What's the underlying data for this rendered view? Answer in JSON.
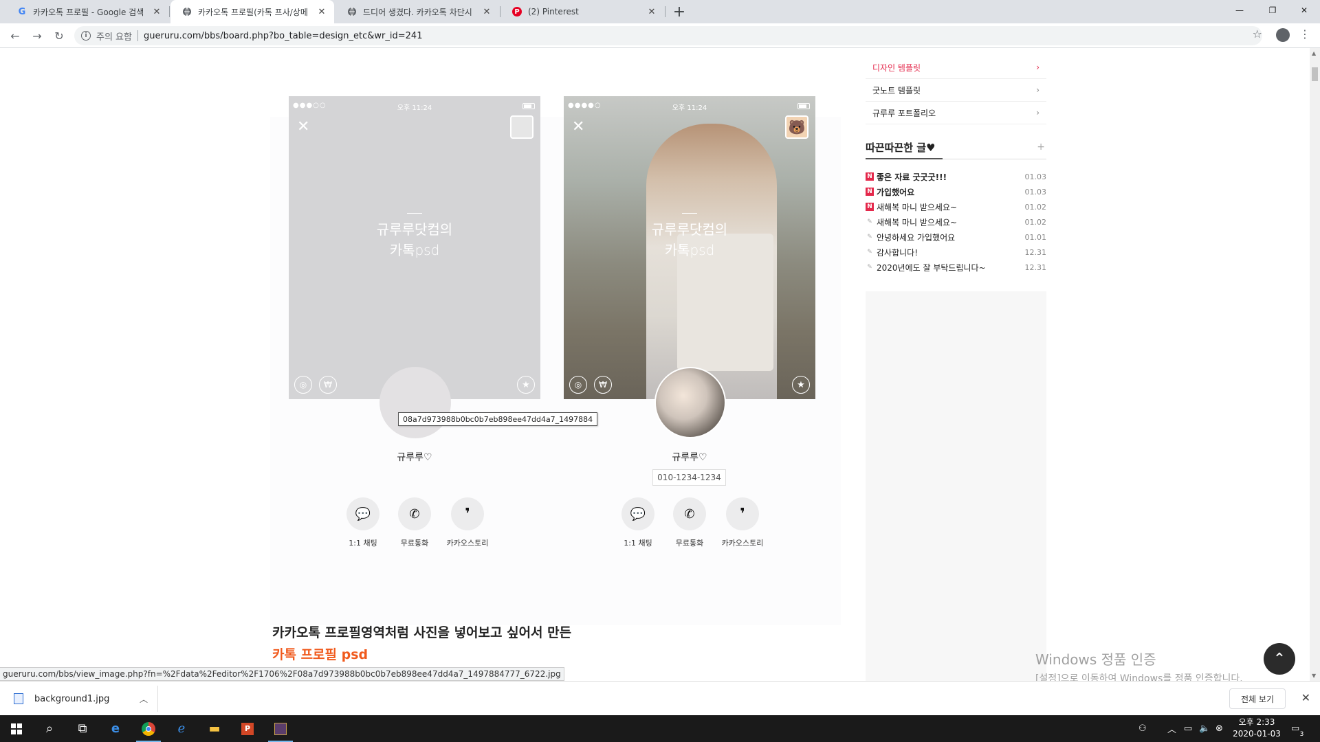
{
  "browser": {
    "tabs": [
      {
        "title": "카카오톡 프로필 - Google 검색",
        "icon": "google-icon",
        "active": false
      },
      {
        "title": "카카오톡 프로필(카톡 프사/상메",
        "icon": "globe-icon",
        "active": true
      },
      {
        "title": "드디어 생겼다. 카카오톡 차단시",
        "icon": "globe-icon",
        "active": false
      },
      {
        "title": "(2) Pinterest",
        "icon": "pinterest-icon",
        "active": false
      }
    ],
    "security_label": "주의 요함",
    "url": "gueruru.com/bbs/board.php?bo_table=design_etc&wr_id=241"
  },
  "mockups": {
    "left": {
      "status_time": "오후 11:24",
      "title_line1": "규루루닷컴의",
      "title_line2": "카톡psd",
      "name": "규루루♡",
      "actions": [
        "1:1 채팅",
        "무료통화",
        "카카오스토리"
      ]
    },
    "right": {
      "status_time": "오후 11:24",
      "title_line1": "규루루닷컴의",
      "title_line2": "카톡psd",
      "name": "규루루♡",
      "phone": "010-1234-1234",
      "actions": [
        "1:1 채팅",
        "무료통화",
        "카카오스토리"
      ]
    },
    "tooltip": "08a7d973988b0bc0b7eb898ee47dd4a7_1497884"
  },
  "post": {
    "line1": "카카오톡 프로필영역처럼 사진을 넣어보고 싶어서 만든",
    "line2": "카톡 프로필 psd"
  },
  "sidebar": {
    "menu": [
      {
        "label": "디자인 템플릿",
        "active": true
      },
      {
        "label": "굿노트 템플릿",
        "active": false
      },
      {
        "label": "규루루 포트폴리오",
        "active": false
      }
    ],
    "recent_title": "따끈따끈한 글♥",
    "recent_plus": "+",
    "posts": [
      {
        "title": "좋은 자료 굿굿굿!!!",
        "date": "01.03",
        "new": true,
        "bold": true
      },
      {
        "title": "가입했어요",
        "date": "01.03",
        "new": true,
        "bold": true
      },
      {
        "title": "새해복 마니 받으세요~",
        "date": "01.02",
        "new": true,
        "bold": false
      },
      {
        "title": "새해복 마니 받으세요~",
        "date": "01.02",
        "new": false,
        "bold": false
      },
      {
        "title": "안녕하세요 가입했어요",
        "date": "01.01",
        "new": false,
        "bold": false
      },
      {
        "title": "감사합니다!",
        "date": "12.31",
        "new": false,
        "bold": false
      },
      {
        "title": "2020년에도 잘 부탁드립니다~",
        "date": "12.31",
        "new": false,
        "bold": false
      }
    ]
  },
  "windows_activation": {
    "line1": "Windows 정품 인증",
    "line2": "[설정]으로 이동하여 Windows를 정품 인증합니다."
  },
  "status_url": "gueruru.com/bbs/view_image.php?fn=%2Fdata%2Feditor%2F1706%2F08a7d973988b0bc0b7eb898ee47dd4a7_1497884777_6722.jpg",
  "download": {
    "filename": "background1.jpg",
    "show_all": "전체 보기"
  },
  "taskbar": {
    "time": "오후 2:33",
    "date": "2020-01-03",
    "notification_count": "3"
  },
  "colors": {
    "accent_red": "#e4284b",
    "post_orange": "#f05a1d",
    "tab_strip": "#dee1e6"
  }
}
